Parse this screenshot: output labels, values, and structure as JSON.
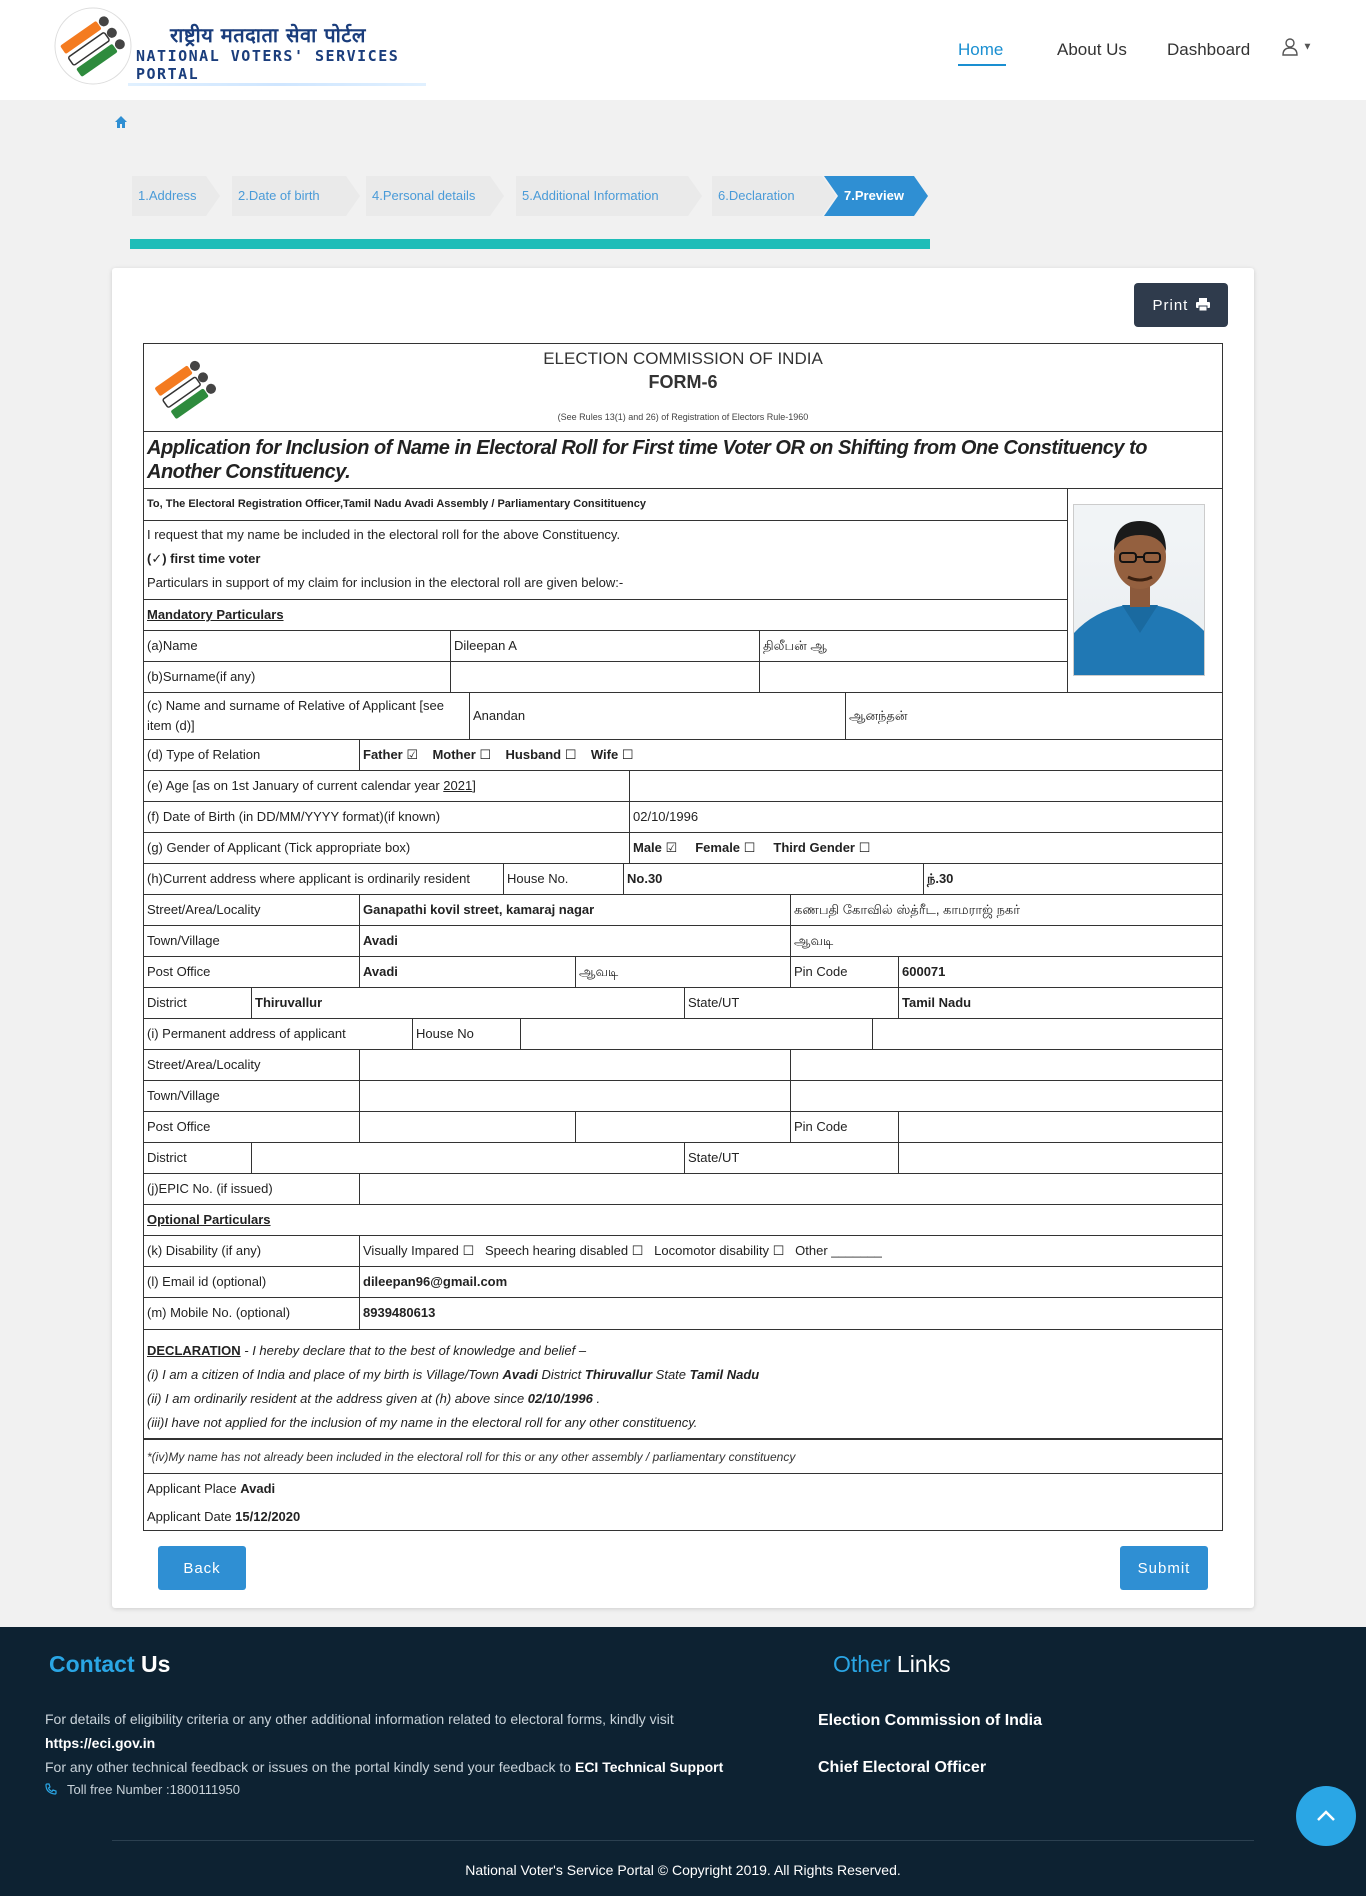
{
  "header": {
    "logo_hindi": "राष्ट्रीय मतदाता सेवा पोर्टल",
    "logo_english": "NATIONAL VOTERS' SERVICES PORTAL",
    "nav": {
      "home": "Home",
      "about": "About Us",
      "dashboard": "Dashboard"
    }
  },
  "steps": [
    "1.Address",
    "2.Date of birth",
    "4.Personal details",
    "5.Additional Information",
    "6.Declaration",
    "7.Preview"
  ],
  "print_label": "Print",
  "form": {
    "eci": "ELECTION COMMISSION OF INDIA",
    "form_no": "FORM-6",
    "rules": "(See Rules 13(1) and 26) of Registration of Electors Rule-1960",
    "title": "Application for Inclusion of Name in Electoral Roll for First time Voter OR on Shifting from One Constituency to Another Constituency.",
    "to": "To, The Electoral Registration Officer,Tamil Nadu Avadi Assembly / Parliamentary Consitituency",
    "request": "I request that my name be included in the electoral roll for the above Constituency.",
    "first_time": "(✓) first time voter",
    "particulars": "Particulars in support of my claim for inclusion in the electoral roll are given below:-",
    "mandatory": "Mandatory Particulars",
    "name_label": "(a)Name",
    "name": "Dileepan A",
    "name_tamil": "திலீபன் ஆ",
    "surname_label": "(b)Surname(if any)",
    "relative_label_1": "(c) Name and surname of Relative of Applicant [see",
    "relative_label_2": "item (d)]",
    "relative": "Anandan",
    "relative_tamil": "ஆனந்தன்",
    "relation_label": "(d) Type of Relation",
    "relation_options": [
      "Father ☑",
      "Mother ☐",
      "Husband ☐",
      "Wife ☐"
    ],
    "age_label": "(e) Age [as on 1st January of current calendar year ",
    "age_year": "2021",
    "age_label_end": "]",
    "dob_label": "(f) Date of Birth (in DD/MM/YYYY format)(if known)",
    "dob": "02/10/1996",
    "gender_label": "(g) Gender of Applicant (Tick appropriate box)",
    "gender_options": [
      "Male ☑",
      "Female ☐",
      "Third Gender ☐"
    ],
    "current_address_label": "(h)Current address where applicant is ordinarily resident",
    "house_no_label": "House No.",
    "house_no": "No.30",
    "house_no_tamil": "ந்.30",
    "street_label": "Street/Area/Locality",
    "street": "Ganapathi kovil street, kamaraj nagar",
    "street_tamil": "கணபதி கோவில் ஸ்த்ரீட, காமராஜ் நகர்",
    "town_label": "Town/Village",
    "town": "Avadi",
    "town_tamil": "ஆவடி",
    "post_office_label": "Post Office",
    "post_office": "Avadi",
    "post_office_tamil": "ஆவடி",
    "pin_label": "Pin Code",
    "pin": "600071",
    "district_label": "District",
    "district": "Thiruvallur",
    "state_label": "State/UT",
    "state": "Tamil Nadu",
    "permanent_label": "(i) Permanent address of applicant",
    "perm_house_label": "House No",
    "epic_label": "(j)EPIC No. (if issued)",
    "optional": "Optional Particulars",
    "disability_label": "(k) Disability (if any)",
    "disability_options": "Visually Impared ☐   Speech hearing disabled ☐   Locomotor disability ☐   Other _______",
    "email_label": "(l) Email id (optional)",
    "email": "dileepan96@gmail.com",
    "mobile_label": "(m) Mobile No. (optional)",
    "mobile": "8939480613",
    "declaration": {
      "heading": "DECLARATION",
      "intro": " - I hereby declare that to the best of knowledge and belief –",
      "l1_a": "(i) I am a citizen of India and place of my birth is Village/Town ",
      "l1_town": "Avadi",
      "l1_b": " District ",
      "l1_district": "Thiruvallur",
      "l1_c": " State ",
      "l1_state": "Tamil Nadu",
      "l2_a": "(ii) I am ordinarily resident at the address given at (h) above since ",
      "l2_date": "02/10/1996",
      "l2_b": " .",
      "l3": "(iii)I have not applied for the inclusion of my name in the electoral roll for any other constituency.",
      "l4": "*(iv)My name has not already been included in the electoral roll for this or any other assembly / parliamentary constituency"
    },
    "place_label": "Applicant Place ",
    "place": "Avadi",
    "date_label": "Applicant Date ",
    "date": "15/12/2020"
  },
  "buttons": {
    "back": "Back",
    "submit": "Submit"
  },
  "footer": {
    "contact_a": "Contact",
    "contact_b": " Us",
    "other_a": "Other",
    "other_b": " Links",
    "txt1": "For details of eligibility criteria or any other additional information related to electoral forms, kindly visit",
    "url": "https://eci.gov.in",
    "txt2": "For any other technical feedback or issues on the portal kindly send your feedback to ",
    "support": "ECI Technical Support",
    "toll": "Toll free Number :1800111950",
    "link1": "Election Commission of India",
    "link2": "Chief Electoral Officer",
    "copyright": "National Voter's Service Portal © Copyright 2019. All Rights Reserved."
  },
  "colors": {
    "accent": "#2f8fd3",
    "teal": "#1ebdb8",
    "footer_bg": "#0d2232"
  }
}
